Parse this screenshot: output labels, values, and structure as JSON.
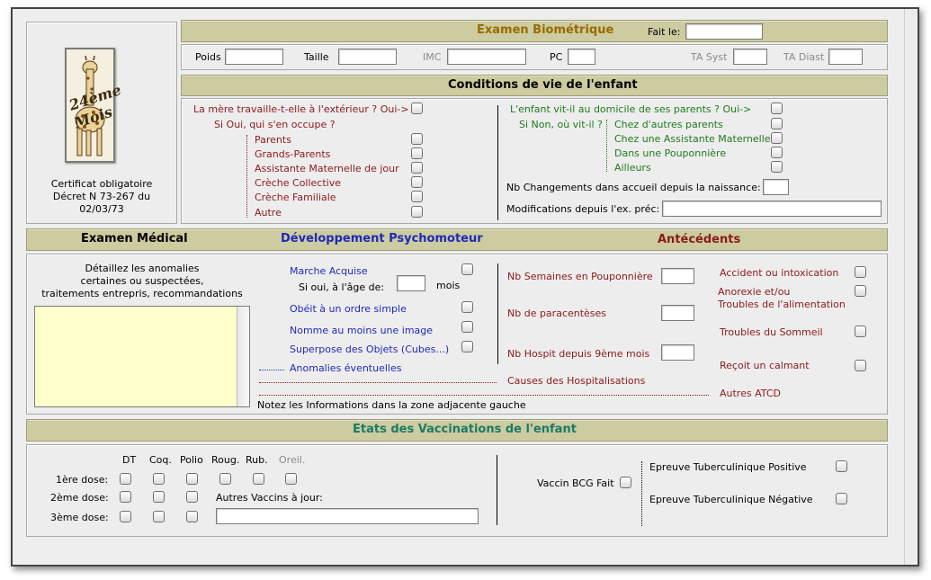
{
  "logo": {
    "text_line1": "24ème",
    "text_line2": "Mois"
  },
  "certificate": {
    "line1": "Certificat obligatoire",
    "line2": "Décret N 73-267 du",
    "line3": "02/03/73"
  },
  "biometrie": {
    "title": "Examen Biométrique",
    "fait_le_label": "Fait le:",
    "fields": {
      "poids": "Poids",
      "taille": "Taille",
      "imc": "IMC",
      "pc": "PC",
      "ta_syst": "TA Syst",
      "ta_diast": "TA Diast"
    }
  },
  "conditions": {
    "title": "Conditions de vie de l'enfant",
    "mother_question": "La mère travaille-t-elle à l'extérieur ? Oui->",
    "who_question": "Si Oui, qui s'en  occupe ?",
    "who_options": [
      "Parents",
      "Grands-Parents",
      "Assistante Maternelle de jour",
      "Crèche Collective",
      "Crèche Familiale",
      "Autre"
    ],
    "home_question": "L'enfant vit-il au domicile de ses parents ?  Oui->",
    "where_question": "Si Non, où vit-il ?",
    "where_options": [
      "Chez d'autres parents",
      "Chez une Assistante Maternelle",
      "Dans une Pouponnière",
      "Ailleurs"
    ],
    "changes_label": "Nb Changements dans accueil depuis la naissance:",
    "modifications_label": "Modifications depuis l'ex. préc:"
  },
  "medical": {
    "title": "Examen Médical",
    "notes_line1": "Détaillez les anomalies",
    "notes_line2": "certaines ou suspectées,",
    "notes_line3": "traitements entrepris, recommandations",
    "footer_note": "Notez les Informations dans la zone adjacente gauche"
  },
  "psychomoteur": {
    "title": "Développement Psychomoteur",
    "marche": "Marche Acquise",
    "age_label": "Si oui, à l'âge de:",
    "mois": "mois",
    "items": [
      "Obéit à un ordre simple",
      "Nomme au moins une image",
      "Superpose des Objets (Cubes...)"
    ],
    "anomalies": "Anomalies éventuelles"
  },
  "antecedents": {
    "title": "Antécédents",
    "left": [
      "Nb Semaines en Pouponnière",
      "Nb de paracentèses",
      "Nb Hospit depuis 9ème mois"
    ],
    "causes": "Causes des Hospitalisations",
    "right": [
      "Accident ou intoxication",
      "Anorexie et/ou",
      "Troubles de l'alimentation",
      "Troubles du Sommeil",
      "Reçoit un calmant"
    ],
    "autres": "Autres ATCD"
  },
  "vaccinations": {
    "title": "Etats des Vaccinations de l'enfant",
    "columns": [
      "DT",
      "Coq.",
      "Polio",
      "Roug.",
      "Rub.",
      "Oreil."
    ],
    "rows": [
      "1ère dose:",
      "2ème dose:",
      "3ème dose:"
    ],
    "autres_label": "Autres Vaccins à jour:",
    "bcg": "Vaccin BCG Fait",
    "tuber_pos": "Epreuve Tuberculinique Positive",
    "tuber_neg": "Epreuve Tuberculinique Négative"
  },
  "colors": {
    "band": "#cdcba0",
    "title_gold": "#9a6a00",
    "title_green": "#1a7a66",
    "red": "#8b1a1a",
    "blue": "#1f2ab8",
    "green": "#1f7a1f",
    "notes_bg": "#ffffcc"
  }
}
